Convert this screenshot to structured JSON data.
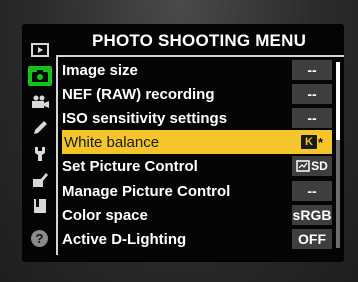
{
  "menu": {
    "title": "PHOTO SHOOTING MENU",
    "help_glyph": "?",
    "items": [
      {
        "label": "Image size",
        "value": "--"
      },
      {
        "label": "NEF (RAW) recording",
        "value": "--"
      },
      {
        "label": "ISO sensitivity settings",
        "value": "--"
      },
      {
        "label": "White balance",
        "value": "K",
        "value_suffix": "*",
        "selected": true
      },
      {
        "label": "Set Picture Control",
        "value": "SD"
      },
      {
        "label": "Manage Picture Control",
        "value": "--"
      },
      {
        "label": "Color space",
        "value": "sRGB"
      },
      {
        "label": "Active D-Lighting",
        "value": "OFF"
      }
    ]
  },
  "tabs": [
    {
      "icon": "playback-icon"
    },
    {
      "icon": "camera-icon",
      "active": true
    },
    {
      "icon": "movie-camera-icon"
    },
    {
      "icon": "pencil-icon"
    },
    {
      "icon": "wrench-icon"
    },
    {
      "icon": "retouch-icon"
    },
    {
      "icon": "my-menu-icon"
    }
  ],
  "colors": {
    "accent_green": "#14c21d",
    "highlight_yellow": "#f5c62c",
    "value_box": "#3e3e3e"
  }
}
